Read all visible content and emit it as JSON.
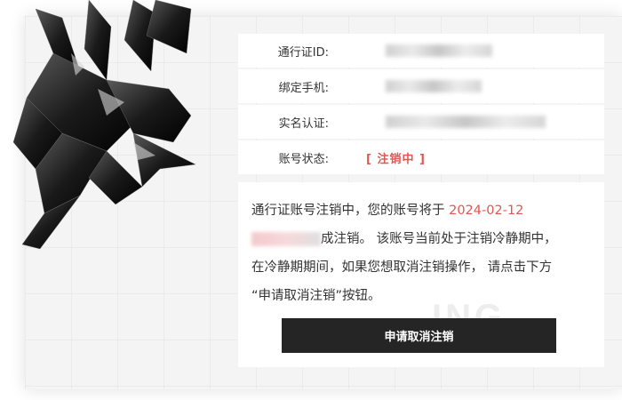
{
  "account": {
    "rows": [
      {
        "label": "通行证ID:"
      },
      {
        "label": "绑定手机:"
      },
      {
        "label": "实名认证:"
      },
      {
        "label": "账号状态:"
      }
    ],
    "status_value": "[ 注销中 ]",
    "status_color": "#e0584f"
  },
  "notice": {
    "line1_text": "通行证账号注销中，您的账号将于 ",
    "date": "2024-02-12",
    "line2_text": "成注销。 该账号当前处于注销冷静期中，",
    "line3_text": "在冷静期期间，如果您想取消注销操作， 请点击下方",
    "line4_text": "“申请取消注销”按钮。",
    "accent_color": "#e0584f"
  },
  "cancel_button_label": "申请取消注销",
  "icons": {
    "mascot": "dark-crystal-creature-icon"
  }
}
